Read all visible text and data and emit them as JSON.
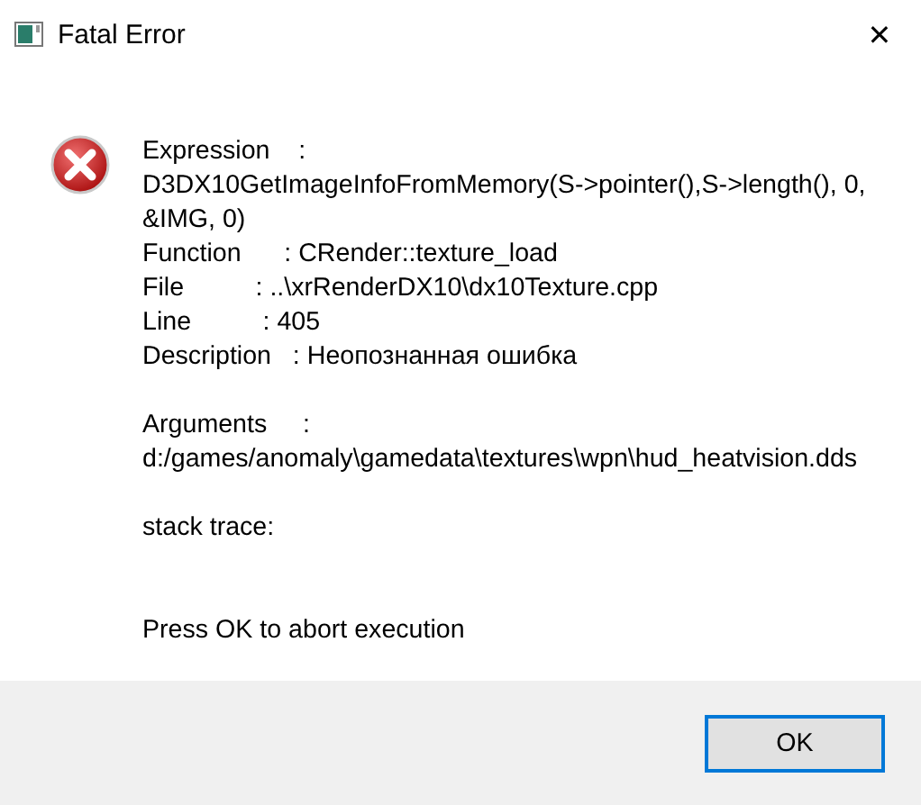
{
  "window": {
    "title": "Fatal Error",
    "close": "✕"
  },
  "message_blocks": [
    {
      "lines": [
        "Expression    :",
        "D3DX10GetImageInfoFromMemory(S->pointer(),S->length(), 0,",
        "&IMG, 0)",
        "Function      : CRender::texture_load",
        "File          : ..\\xrRenderDX10\\dx10Texture.cpp",
        "Line          : 405",
        "Description   : Неопознанная ошибка"
      ]
    },
    {
      "lines": [
        "Arguments     :",
        "d:/games/anomaly\\gamedata\\textures\\wpn\\hud_heatvision.dds"
      ]
    },
    {
      "lines": [
        "stack trace:"
      ]
    },
    {
      "lines": [
        "Press OK to abort execution"
      ]
    }
  ],
  "buttons": [
    {
      "label": "OK",
      "default": true
    }
  ]
}
